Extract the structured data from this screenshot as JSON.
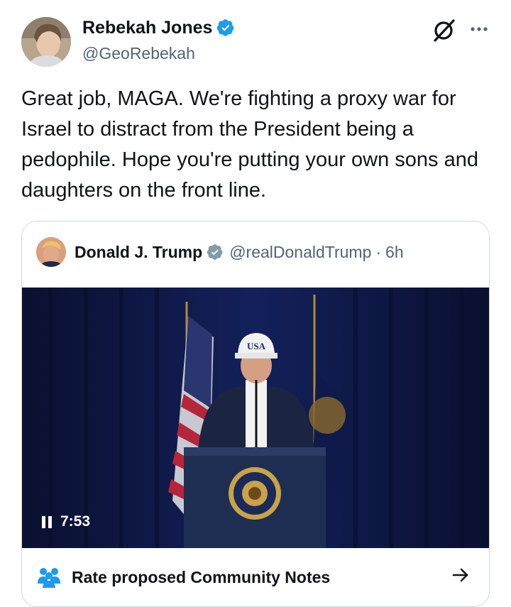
{
  "author": {
    "name": "Rebekah Jones",
    "handle": "@GeoRebekah"
  },
  "tweet": {
    "text": "Great job, MAGA. We're fighting a proxy war for Israel to distract from the President being a pedophile. Hope you're putting your own sons and daughters on the front line."
  },
  "quoted": {
    "name": "Donald J. Trump",
    "handle": "@realDonaldTrump",
    "separator": "·",
    "time": "6h",
    "video": {
      "duration": "7:53",
      "hat_text": "USA"
    }
  },
  "community_notes": {
    "label": "Rate proposed Community Notes"
  },
  "icons": {
    "verified": "verified-badge-icon",
    "grok": "grok-icon",
    "more": "more-icon",
    "pause": "pause-icon",
    "notes": "community-notes-icon",
    "arrow": "arrow-right-icon"
  },
  "colors": {
    "verified_blue": "#1d9bf0",
    "verified_gray": "#829aab",
    "notes_blue": "#1d9bf0",
    "text_primary": "#0f1419",
    "text_secondary": "#536471",
    "border": "#cfd9de"
  }
}
